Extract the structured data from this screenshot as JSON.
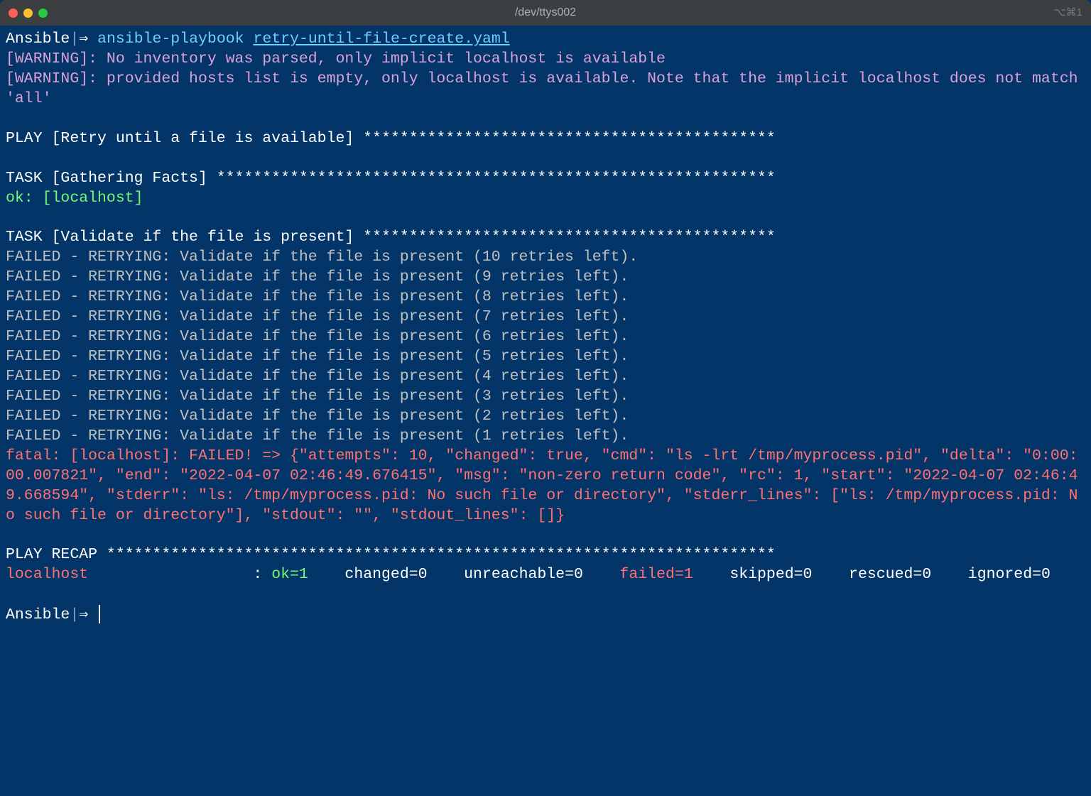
{
  "titlebar": {
    "title": "/dev/ttys002",
    "right_indicator": "⌥⌘1"
  },
  "prompt": {
    "project": "Ansible",
    "separator": "|",
    "arrow": "⇒ ",
    "command": "ansible-playbook ",
    "arg": "retry-until-file-create.yaml"
  },
  "warnings": [
    "[WARNING]: No inventory was parsed, only implicit localhost is available",
    "[WARNING]: provided hosts list is empty, only localhost is available. Note that the implicit localhost does not match 'all'"
  ],
  "play_header": "PLAY [Retry until a file is available] *********************************************",
  "task_gather_header": "TASK [Gathering Facts] *************************************************************",
  "gather_ok": "ok: [localhost]",
  "task_validate_header": "TASK [Validate if the file is present] *********************************************",
  "retries": [
    "FAILED - RETRYING: Validate if the file is present (10 retries left).",
    "FAILED - RETRYING: Validate if the file is present (9 retries left).",
    "FAILED - RETRYING: Validate if the file is present (8 retries left).",
    "FAILED - RETRYING: Validate if the file is present (7 retries left).",
    "FAILED - RETRYING: Validate if the file is present (6 retries left).",
    "FAILED - RETRYING: Validate if the file is present (5 retries left).",
    "FAILED - RETRYING: Validate if the file is present (4 retries left).",
    "FAILED - RETRYING: Validate if the file is present (3 retries left).",
    "FAILED - RETRYING: Validate if the file is present (2 retries left).",
    "FAILED - RETRYING: Validate if the file is present (1 retries left)."
  ],
  "fatal": "fatal: [localhost]: FAILED! => {\"attempts\": 10, \"changed\": true, \"cmd\": \"ls -lrt /tmp/myprocess.pid\", \"delta\": \"0:00:00.007821\", \"end\": \"2022-04-07 02:46:49.676415\", \"msg\": \"non-zero return code\", \"rc\": 1, \"start\": \"2022-04-07 02:46:49.668594\", \"stderr\": \"ls: /tmp/myprocess.pid: No such file or directory\", \"stderr_lines\": [\"ls: /tmp/myprocess.pid: No such file or directory\"], \"stdout\": \"\", \"stdout_lines\": []}",
  "recap_header": "PLAY RECAP *************************************************************************",
  "recap": {
    "host": "localhost",
    "host_pad": "                 ",
    "sep": " : ",
    "ok": "ok=1   ",
    "changed": " changed=0   ",
    "unreachable": " unreachable=0   ",
    "failed": " failed=1   ",
    "skipped": " skipped=0   ",
    "rescued": " rescued=0   ",
    "ignored": " ignored=0"
  }
}
